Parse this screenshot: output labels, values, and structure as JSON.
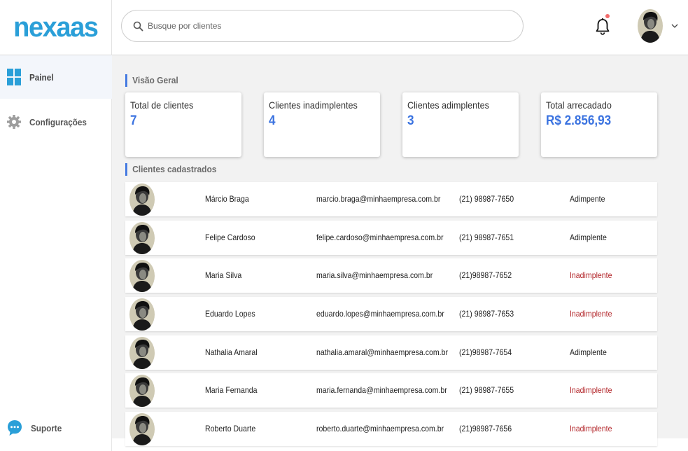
{
  "brand": {
    "logo_text": "nexaas",
    "logo_color": "#2a9fd8"
  },
  "header": {
    "search": {
      "placeholder": "Busque por clientes",
      "value": ""
    },
    "notification_icon": "bell-icon",
    "notification_dot_color": "#f26b6b",
    "user_menu_icon": "chevron-down-icon"
  },
  "sidebar": {
    "items": [
      {
        "label": "Painel",
        "icon": "dashboard-grid-icon",
        "active": true
      },
      {
        "label": "Configurações",
        "icon": "gear-icon",
        "active": false
      }
    ],
    "support": {
      "label": "Suporte",
      "icon": "chat-bubble-icon"
    }
  },
  "overview": {
    "title": "Visão Geral",
    "cards": [
      {
        "label": "Total de clientes",
        "value": "7"
      },
      {
        "label": "Clientes inadimplentes",
        "value": "4"
      },
      {
        "label": "Clientes adimplentes",
        "value": "3"
      },
      {
        "label": "Total arrecadado",
        "value": "R$ 2.856,93"
      }
    ]
  },
  "clients": {
    "title": "Clientes cadastrados",
    "rows": [
      {
        "name": "Márcio Braga",
        "email": "marcio.braga@minhaempresa.com.br",
        "phone": "(21) 98987-7650",
        "status": "Adimpente",
        "overdue": false
      },
      {
        "name": "Felipe Cardoso",
        "email": "felipe.cardoso@minhaempresa.com.br",
        "phone": "(21) 98987-7651",
        "status": "Adimplente",
        "overdue": false
      },
      {
        "name": "Maria Silva",
        "email": "maria.silva@minhaempresa.com.br",
        "phone": "(21)98987-7652",
        "status": "Inadimplente",
        "overdue": true
      },
      {
        "name": "Eduardo Lopes",
        "email": "eduardo.lopes@minhaempresa.com.br",
        "phone": "(21) 98987-7653",
        "status": "Inadimplente",
        "overdue": true
      },
      {
        "name": "Nathalia Amaral",
        "email": "nathalia.amaral@minhaempresa.com.br",
        "phone": "(21)98987-7654",
        "status": "Adimplente",
        "overdue": false
      },
      {
        "name": "Maria Fernanda",
        "email": "maria.fernanda@minhaempresa.com.br",
        "phone": "(21) 98987-7655",
        "status": "Inadimplente",
        "overdue": true
      },
      {
        "name": "Roberto Duarte",
        "email": "roberto.duarte@minhaempresa.com.br",
        "phone": "(21)98987-7656",
        "status": "Inadimplente",
        "overdue": true
      }
    ]
  },
  "colors": {
    "accent": "#3b73e0",
    "overdue": "#b3262a",
    "main_background": "#f2f2f2"
  }
}
